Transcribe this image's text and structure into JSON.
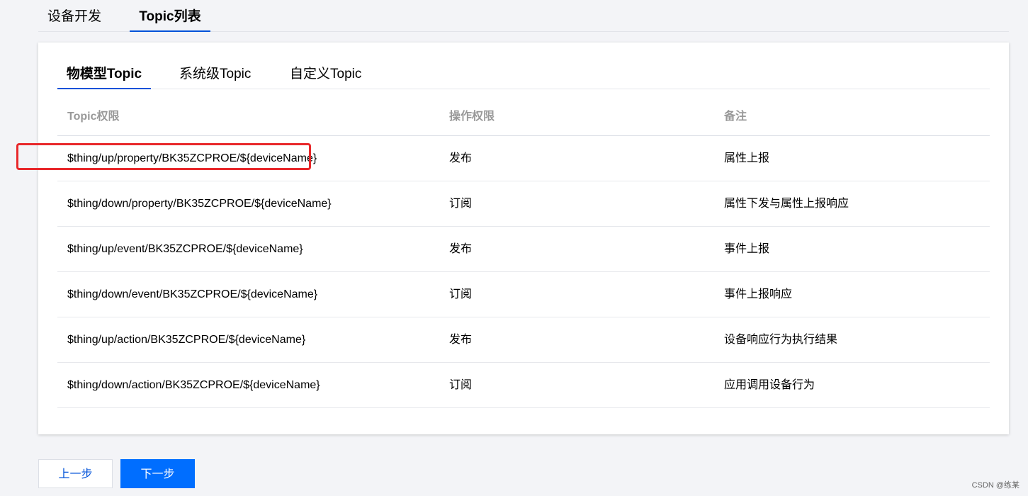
{
  "top_tabs": {
    "items": [
      {
        "label": "设备开发",
        "active": false
      },
      {
        "label": "Topic列表",
        "active": true
      }
    ],
    "active_underline_color": "#0052d9"
  },
  "sub_tabs": {
    "items": [
      {
        "label": "物模型Topic",
        "active": true
      },
      {
        "label": "系统级Topic",
        "active": false
      },
      {
        "label": "自定义Topic",
        "active": false
      }
    ]
  },
  "table": {
    "headers": [
      "Topic权限",
      "操作权限",
      "备注"
    ],
    "rows": [
      {
        "topic": "$thing/up/property/BK35ZCPROE/${deviceName}",
        "permission": "发布",
        "note": "属性上报"
      },
      {
        "topic": "$thing/down/property/BK35ZCPROE/${deviceName}",
        "permission": "订阅",
        "note": "属性下发与属性上报响应"
      },
      {
        "topic": "$thing/up/event/BK35ZCPROE/${deviceName}",
        "permission": "发布",
        "note": "事件上报"
      },
      {
        "topic": "$thing/down/event/BK35ZCPROE/${deviceName}",
        "permission": "订阅",
        "note": "事件上报响应"
      },
      {
        "topic": "$thing/up/action/BK35ZCPROE/${deviceName}",
        "permission": "发布",
        "note": "设备响应行为执行结果"
      },
      {
        "topic": "$thing/down/action/BK35ZCPROE/${deviceName}",
        "permission": "订阅",
        "note": "应用调用设备行为"
      }
    ],
    "highlight_color": "#e8282b"
  },
  "footer": {
    "prev_label": "上一步",
    "next_label": "下一步",
    "primary_color": "#006eff"
  },
  "watermark": "CSDN @练某"
}
